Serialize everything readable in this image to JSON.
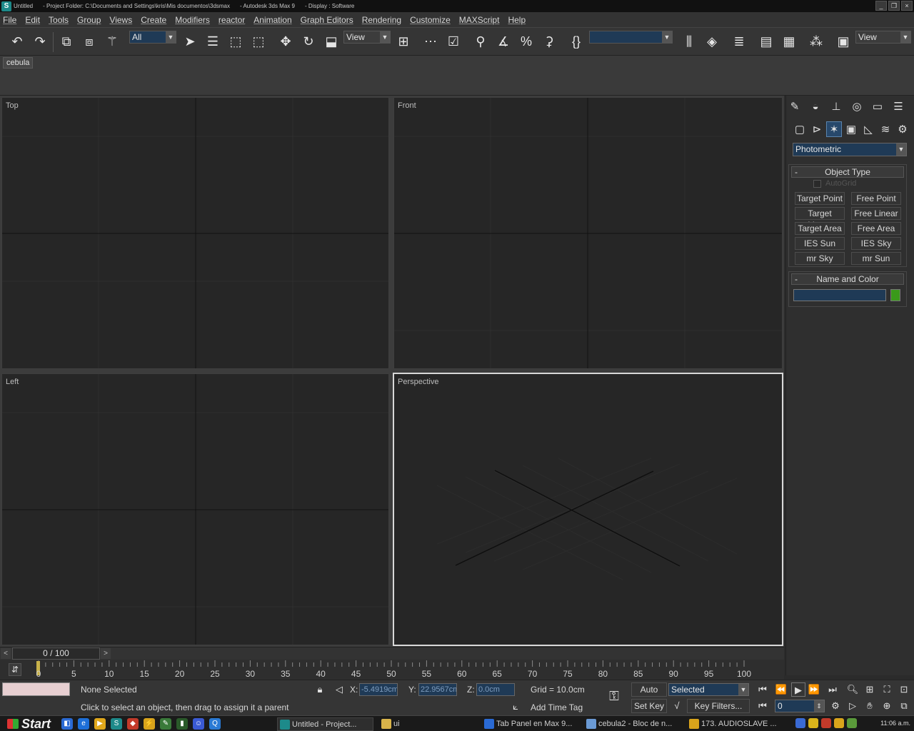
{
  "titlebar": {
    "segments": [
      "Untitled",
      "- Project Folder: C:\\Documents and Settings\\kris\\Mis documentos\\3dsmax",
      "- Autodesk 3ds Max 9",
      "- Display : Software"
    ]
  },
  "menu": [
    "File",
    "Edit",
    "Tools",
    "Group",
    "Views",
    "Create",
    "Modifiers",
    "reactor",
    "Animation",
    "Graph Editors",
    "Rendering",
    "Customize",
    "MAXScript",
    "Help"
  ],
  "toolbar": {
    "selection_filter": "All",
    "ref_coord": "View",
    "named_selection": "",
    "view_dropdown": "View"
  },
  "tab": {
    "label": "cebula"
  },
  "viewports": {
    "top": "Top",
    "front": "Front",
    "left": "Left",
    "perspective": "Perspective"
  },
  "command_panel": {
    "category_dropdown": "Photometric",
    "object_type": {
      "title": "Object Type",
      "minus": "-",
      "autogrid": "AutoGrid",
      "buttons": [
        "Target Point",
        "Free Point",
        "Target Linear",
        "Free Linear",
        "Target Area",
        "Free Area",
        "IES Sun",
        "IES Sky",
        "mr Sky",
        "mr Sun"
      ]
    },
    "name_color": {
      "title": "Name and Color",
      "minus": "-",
      "name_value": "",
      "color": "#3a9a1a"
    }
  },
  "time_slider": {
    "label": "0 / 100",
    "left_arrow": "<",
    "right_arrow": ">"
  },
  "track": {
    "ticks": [
      "0",
      "5",
      "10",
      "15",
      "20",
      "25",
      "30",
      "35",
      "40",
      "45",
      "50",
      "55",
      "60",
      "65",
      "70",
      "75",
      "80",
      "85",
      "90",
      "95",
      "100"
    ]
  },
  "status": {
    "selection": "None Selected",
    "prompt": "Click to select an object, then drag to assign it a parent",
    "x_label": "X:",
    "x_value": "-5.4919cm",
    "y_label": "Y:",
    "y_value": "22.9567cm",
    "z_label": "Z:",
    "z_value": "0.0cm",
    "grid": "Grid = 10.0cm",
    "add_time_tag": "Add Time Tag",
    "auto_key": "Auto Key",
    "set_key": "Set Key",
    "key_mode": "Selected",
    "key_filters": "Key Filters...",
    "frame": "0"
  },
  "taskbar": {
    "start": "Start",
    "tasks": [
      "Untitled     - Project...",
      "ui",
      "Tab Panel en Max 9...",
      "cebula2 - Bloc de n...",
      "173. AUDIOSLAVE ..."
    ],
    "clock": "11:06 a.m."
  },
  "colors": {
    "accent": "#1f3a56",
    "viewport_bg": "#262626",
    "listener": "#e7cfd1"
  }
}
